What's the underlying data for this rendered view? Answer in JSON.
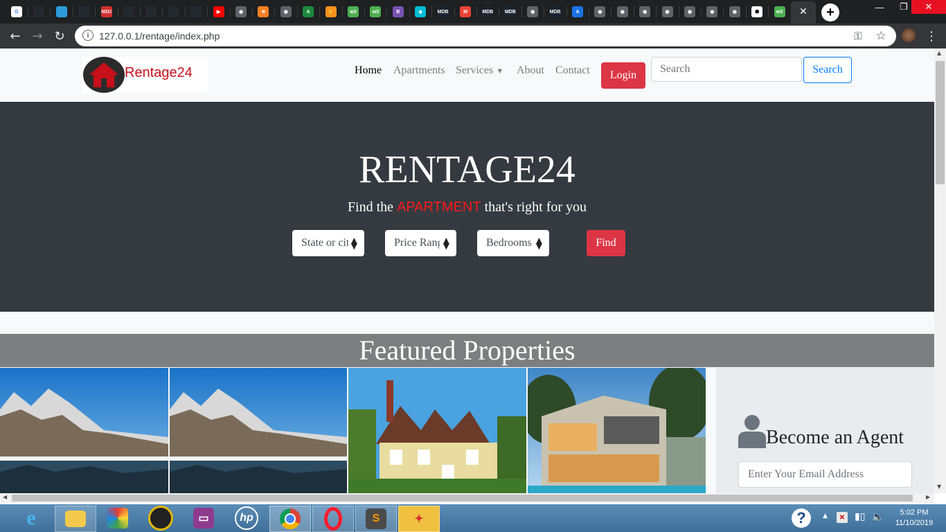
{
  "browser": {
    "url": "127.0.0.1/rentage/index.php",
    "new_tab_label": "+",
    "active_tab_close": "✕",
    "window_controls": {
      "minimize": "—",
      "restore": "❐",
      "close": "✕"
    },
    "favicons": [
      {
        "label": "G",
        "color": "#ffffff",
        "text": "#4285f4"
      },
      {
        "label": "",
        "color": "#24292e"
      },
      {
        "label": "",
        "color": "#2d9cdb"
      },
      {
        "label": "",
        "color": "#24292e"
      },
      {
        "label": "NSU",
        "color": "#d32f2f"
      },
      {
        "label": "",
        "color": "#24292e"
      },
      {
        "label": "",
        "color": "#24292e"
      },
      {
        "label": "",
        "color": "#24292e"
      },
      {
        "label": "",
        "color": "#24292e"
      },
      {
        "label": "▶",
        "color": "#ff0000"
      },
      {
        "label": "◉",
        "color": "#5f6368"
      },
      {
        "label": "≋",
        "color": "#f48024"
      },
      {
        "label": "◉",
        "color": "#5f6368"
      },
      {
        "label": "A",
        "color": "#1b8a3d"
      },
      {
        "label": "⚡",
        "color": "#f7931e"
      },
      {
        "label": "w3",
        "color": "#4caf50"
      },
      {
        "label": "w3",
        "color": "#4caf50"
      },
      {
        "label": "B",
        "color": "#7952b3"
      },
      {
        "label": "◆",
        "color": "#00bcd4"
      },
      {
        "label": "MDB",
        "color": "#1c2331"
      },
      {
        "label": "M",
        "color": "#ea4335"
      },
      {
        "label": "MDB",
        "color": "#1c2331"
      },
      {
        "label": "MDB",
        "color": "#1c2331"
      },
      {
        "label": "◉",
        "color": "#5f6368"
      },
      {
        "label": "MDB",
        "color": "#1c2331"
      },
      {
        "label": "A",
        "color": "#1a73e8"
      },
      {
        "label": "◉",
        "color": "#5f6368"
      },
      {
        "label": "◉",
        "color": "#5f6368"
      },
      {
        "label": "◉",
        "color": "#5f6368"
      },
      {
        "label": "◉",
        "color": "#5f6368"
      },
      {
        "label": "◉",
        "color": "#5f6368"
      },
      {
        "label": "◉",
        "color": "#5f6368"
      },
      {
        "label": "◉",
        "color": "#5f6368"
      },
      {
        "label": "⬢",
        "color": "#ffffff",
        "text": "#000000"
      },
      {
        "label": "w3",
        "color": "#4caf50"
      }
    ]
  },
  "site": {
    "logo_text": "Rentage24",
    "nav": [
      "Home",
      "Apartments",
      "Services",
      "About",
      "Contact"
    ],
    "login": "Login",
    "search_placeholder": "Search",
    "search_button": "Search",
    "hero_title": "RENTAGE24",
    "hero_sub_before": "Find the",
    "hero_sub_highlight": "APARTMENT",
    "hero_sub_after": "that's right for you",
    "selects": [
      "State or city",
      "Price Range",
      "Bedrooms"
    ],
    "find": "Find",
    "featured_title": "Featured Properties",
    "agent_title": "Become an Agent",
    "agent_placeholder": "Enter Your Email Address"
  },
  "taskbar": {
    "apps": [
      "internet-explorer",
      "file-explorer",
      "paint-app",
      "media-app",
      "presentation-app",
      "hp-app",
      "chrome",
      "opera",
      "sublime-text",
      "rocket-app"
    ],
    "time": "5:02 PM",
    "date": "11/10/2019"
  },
  "colors": {
    "brand_red": "#dc3545",
    "hero_bg": "#343a40",
    "featured_bg": "#7d7e80",
    "link_blue": "#007bff",
    "highlight_red": "#ff1a1a"
  }
}
